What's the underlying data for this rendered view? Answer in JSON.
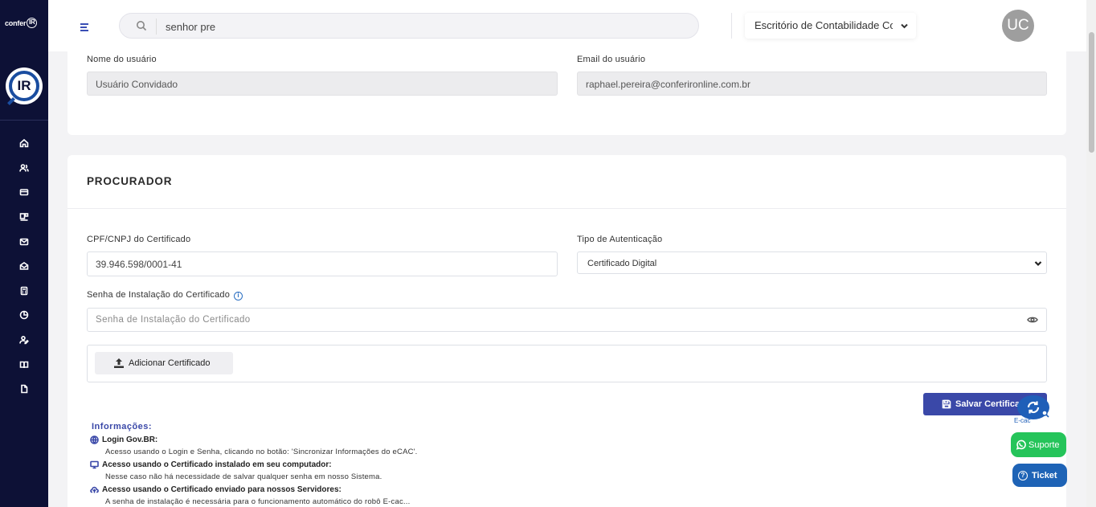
{
  "brand": {
    "text": "confer",
    "ring": "IR",
    "logo_text": "IR"
  },
  "sidebar": {
    "items": [
      {
        "icon": "home-icon"
      },
      {
        "icon": "users-icon"
      },
      {
        "icon": "card-icon"
      },
      {
        "icon": "dashboard-icon"
      },
      {
        "icon": "mail-icon"
      },
      {
        "icon": "mail-open-icon"
      },
      {
        "icon": "calculator-icon"
      },
      {
        "icon": "pie-chart-icon"
      },
      {
        "icon": "user-edit-icon"
      },
      {
        "icon": "book-icon"
      },
      {
        "icon": "file-icon"
      }
    ]
  },
  "header": {
    "search_value": "senhor pre",
    "office_name": "Escritório de Contabilidade Co",
    "avatar_initials": "UC"
  },
  "user_card": {
    "name_label": "Nome do usuário",
    "name_value": "Usuário Convidado",
    "email_label": "Email do usuário",
    "email_value": "raphael.pereira@conferironline.com.br"
  },
  "procurador": {
    "title": "PROCURADOR",
    "cpf_label": "CPF/CNPJ do Certificado",
    "cpf_value": "39.946.598/0001-41",
    "auth_label": "Tipo de Autenticação",
    "auth_value": "Certificado Digital",
    "password_label": "Senha de Instalação do Certificado",
    "password_placeholder": "Senha de Instalação do Certificado",
    "add_cert_label": "Adicionar Certificado",
    "save_label": "Salvar Certificado"
  },
  "info": {
    "heading": "Informações:",
    "items": [
      {
        "title": "Login Gov.BR:",
        "desc": "Acesso usando o Login e Senha, clicando no botão: 'Sincronizar Informações do eCAC'."
      },
      {
        "title": "Acesso usando o Certificado instalado em seu computador:",
        "desc": "Nesse caso não há necessidade de salvar qualquer senha em nosso Sistema."
      },
      {
        "title": "Acesso usando o Certificado enviado para nossos Servidores:",
        "desc": "A senha de instalação é necessária para o funcionamento automático do robô E-cac..."
      }
    ]
  },
  "widgets": {
    "ecac_label": "E-cac",
    "suporte_label": "Suporte",
    "ticket_label": "Ticket"
  },
  "colors": {
    "sidebar_bg": "#0d1136",
    "primary": "#3a48a8",
    "whatsapp": "#25c45a",
    "ticket": "#1e63b6"
  }
}
